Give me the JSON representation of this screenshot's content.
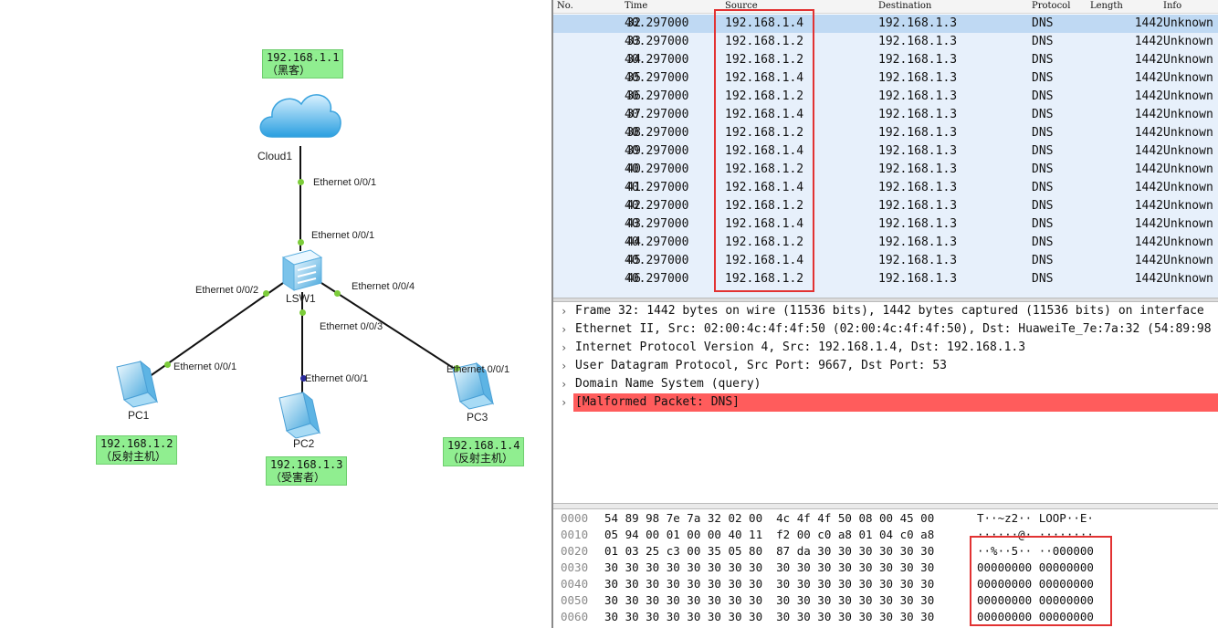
{
  "topology": {
    "nodes": {
      "cloud": {
        "name": "Cloud1",
        "ip": "192.168.1.1\n（黑客）"
      },
      "switch": {
        "name": "LSW1"
      },
      "pc1": {
        "name": "PC1",
        "ip": "192.168.1.2\n（反射主机）"
      },
      "pc2": {
        "name": "PC2",
        "ip": "192.168.1.3\n（受害者）"
      },
      "pc3": {
        "name": "PC3",
        "ip": "192.168.1.4\n（反射主机）"
      }
    },
    "ports": {
      "cloud_port": "Ethernet 0/0/1",
      "sw_up": "Ethernet 0/0/1",
      "sw_p2": "Ethernet 0/0/2",
      "sw_p4": "Ethernet 0/0/4",
      "sw_p3": "Ethernet 0/0/3",
      "pc1_port": "Ethernet 0/0/1",
      "pc2_port": "Ethernet 0/0/1",
      "pc3_port": "Ethernet 0/0/1"
    }
  },
  "packet_list": {
    "columns": {
      "no": "No.",
      "time": "Time",
      "source": "Source",
      "destination": "Destination",
      "protocol": "Protocol",
      "length": "Length",
      "info": "Info"
    },
    "rows": [
      {
        "no": "32",
        "time": "40.297000",
        "source": "192.168.1.4",
        "destination": "192.168.1.3",
        "protocol": "DNS",
        "length": "1442",
        "info": "Unknown"
      },
      {
        "no": "33",
        "time": "40.297000",
        "source": "192.168.1.2",
        "destination": "192.168.1.3",
        "protocol": "DNS",
        "length": "1442",
        "info": "Unknown"
      },
      {
        "no": "34",
        "time": "40.297000",
        "source": "192.168.1.2",
        "destination": "192.168.1.3",
        "protocol": "DNS",
        "length": "1442",
        "info": "Unknown"
      },
      {
        "no": "35",
        "time": "40.297000",
        "source": "192.168.1.4",
        "destination": "192.168.1.3",
        "protocol": "DNS",
        "length": "1442",
        "info": "Unknown"
      },
      {
        "no": "36",
        "time": "40.297000",
        "source": "192.168.1.2",
        "destination": "192.168.1.3",
        "protocol": "DNS",
        "length": "1442",
        "info": "Unknown"
      },
      {
        "no": "37",
        "time": "40.297000",
        "source": "192.168.1.4",
        "destination": "192.168.1.3",
        "protocol": "DNS",
        "length": "1442",
        "info": "Unknown"
      },
      {
        "no": "38",
        "time": "40.297000",
        "source": "192.168.1.2",
        "destination": "192.168.1.3",
        "protocol": "DNS",
        "length": "1442",
        "info": "Unknown"
      },
      {
        "no": "39",
        "time": "40.297000",
        "source": "192.168.1.4",
        "destination": "192.168.1.3",
        "protocol": "DNS",
        "length": "1442",
        "info": "Unknown"
      },
      {
        "no": "40",
        "time": "40.297000",
        "source": "192.168.1.2",
        "destination": "192.168.1.3",
        "protocol": "DNS",
        "length": "1442",
        "info": "Unknown"
      },
      {
        "no": "41",
        "time": "40.297000",
        "source": "192.168.1.4",
        "destination": "192.168.1.3",
        "protocol": "DNS",
        "length": "1442",
        "info": "Unknown"
      },
      {
        "no": "42",
        "time": "40.297000",
        "source": "192.168.1.2",
        "destination": "192.168.1.3",
        "protocol": "DNS",
        "length": "1442",
        "info": "Unknown"
      },
      {
        "no": "43",
        "time": "40.297000",
        "source": "192.168.1.4",
        "destination": "192.168.1.3",
        "protocol": "DNS",
        "length": "1442",
        "info": "Unknown"
      },
      {
        "no": "44",
        "time": "40.297000",
        "source": "192.168.1.2",
        "destination": "192.168.1.3",
        "protocol": "DNS",
        "length": "1442",
        "info": "Unknown"
      },
      {
        "no": "45",
        "time": "40.297000",
        "source": "192.168.1.4",
        "destination": "192.168.1.3",
        "protocol": "DNS",
        "length": "1442",
        "info": "Unknown"
      },
      {
        "no": "46",
        "time": "40.297000",
        "source": "192.168.1.2",
        "destination": "192.168.1.3",
        "protocol": "DNS",
        "length": "1442",
        "info": "Unknown"
      }
    ]
  },
  "details": [
    {
      "text": "Frame 32: 1442 bytes on wire (11536 bits), 1442 bytes captured (11536 bits) on interface",
      "error": false
    },
    {
      "text": "Ethernet II, Src: 02:00:4c:4f:4f:50 (02:00:4c:4f:4f:50), Dst: HuaweiTe_7e:7a:32 (54:89:98",
      "error": false
    },
    {
      "text": "Internet Protocol Version 4, Src: 192.168.1.4, Dst: 192.168.1.3",
      "error": false
    },
    {
      "text": "User Datagram Protocol, Src Port: 9667, Dst Port: 53",
      "error": false
    },
    {
      "text": "Domain Name System (query)",
      "error": false
    },
    {
      "text": "[Malformed Packet: DNS]",
      "error": true
    }
  ],
  "bytes": [
    {
      "offset": "0000",
      "hex": "54 89 98 7e 7a 32 02 00  4c 4f 4f 50 08 00 45 00",
      "ascii": "T··~z2·· LOOP··E·"
    },
    {
      "offset": "0010",
      "hex": "05 94 00 01 00 00 40 11  f2 00 c0 a8 01 04 c0 a8",
      "ascii": "······@· ········"
    },
    {
      "offset": "0020",
      "hex": "01 03 25 c3 00 35 05 80  87 da 30 30 30 30 30 30",
      "ascii": "··%··5·· ··000000"
    },
    {
      "offset": "0030",
      "hex": "30 30 30 30 30 30 30 30  30 30 30 30 30 30 30 30",
      "ascii": "00000000 00000000"
    },
    {
      "offset": "0040",
      "hex": "30 30 30 30 30 30 30 30  30 30 30 30 30 30 30 30",
      "ascii": "00000000 00000000"
    },
    {
      "offset": "0050",
      "hex": "30 30 30 30 30 30 30 30  30 30 30 30 30 30 30 30",
      "ascii": "00000000 00000000"
    },
    {
      "offset": "0060",
      "hex": "30 30 30 30 30 30 30 30  30 30 30 30 30 30 30 30",
      "ascii": "00000000 00000000"
    }
  ],
  "colors": {
    "selected_row": "#bfd9f3",
    "row_bg": "#e7f0fb",
    "error_bg": "#ff5c5c",
    "highlight_box": "#e23232",
    "ip_label_bg": "#90ee90"
  }
}
